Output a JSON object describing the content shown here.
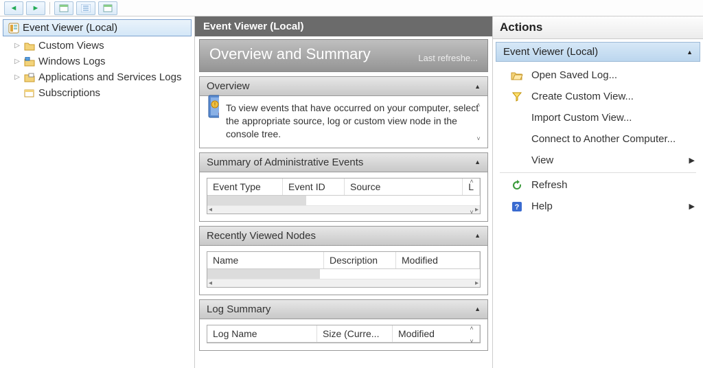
{
  "tree": {
    "root": "Event Viewer (Local)",
    "items": [
      {
        "label": "Custom Views"
      },
      {
        "label": "Windows Logs"
      },
      {
        "label": "Applications and Services Logs"
      },
      {
        "label": "Subscriptions"
      }
    ]
  },
  "center": {
    "title": "Event Viewer (Local)",
    "overview_heading": "Overview and Summary",
    "last_refreshed": "Last refreshe...",
    "sections": {
      "overview": {
        "header": "Overview",
        "text": "To view events that have occurred on your computer, select the appropriate source, log or custom view node in the console tree."
      },
      "admin": {
        "header": "Summary of Administrative Events",
        "cols": [
          "Event Type",
          "Event ID",
          "Source",
          "L"
        ]
      },
      "recent": {
        "header": "Recently Viewed Nodes",
        "cols": [
          "Name",
          "Description",
          "Modified"
        ]
      },
      "log": {
        "header": "Log Summary",
        "cols": [
          "Log Name",
          "Size (Curre...",
          "Modified"
        ]
      }
    }
  },
  "actions": {
    "title": "Actions",
    "subtitle": "Event Viewer (Local)",
    "items": [
      {
        "label": "Open Saved Log...",
        "icon": "folder"
      },
      {
        "label": "Create Custom View...",
        "icon": "funnel"
      },
      {
        "label": "Import Custom View...",
        "icon": "none"
      },
      {
        "label": "Connect to Another Computer...",
        "icon": "none"
      },
      {
        "label": "View",
        "icon": "none",
        "arrow": true,
        "divider_after": true
      },
      {
        "label": "Refresh",
        "icon": "refresh"
      },
      {
        "label": "Help",
        "icon": "help",
        "arrow": true
      }
    ]
  }
}
